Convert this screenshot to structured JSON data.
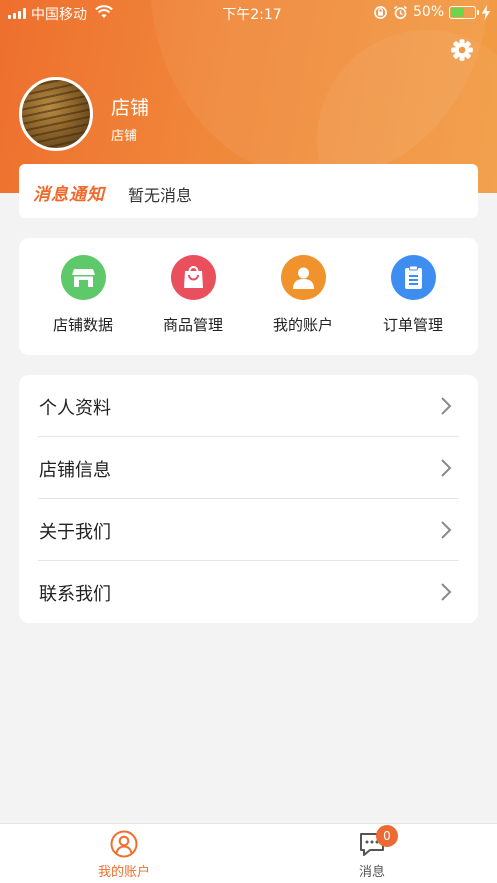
{
  "status_bar": {
    "carrier": "中国移动",
    "time": "下午2:17",
    "battery": "50%"
  },
  "profile": {
    "store_name": "店铺",
    "store_sub": "店铺"
  },
  "notice": {
    "tag": "消息通知",
    "text": "暂无消息"
  },
  "quick_menu": [
    {
      "label": "店铺数据",
      "icon": "store-icon",
      "color": "#5dc96b"
    },
    {
      "label": "商品管理",
      "icon": "shopping-bag-icon",
      "color": "#ea4f5e"
    },
    {
      "label": "我的账户",
      "icon": "user-icon",
      "color": "#f0932c"
    },
    {
      "label": "订单管理",
      "icon": "clipboard-icon",
      "color": "#3d8ef0"
    }
  ],
  "settings_list": [
    {
      "label": "个人资料"
    },
    {
      "label": "店铺信息"
    },
    {
      "label": "关于我们"
    },
    {
      "label": "联系我们"
    }
  ],
  "tabbar": {
    "items": [
      {
        "label": "我的账户",
        "icon": "user-circle-icon",
        "active": true
      },
      {
        "label": "消息",
        "icon": "chat-icon",
        "active": false
      }
    ],
    "message_badge": "0"
  },
  "colors": {
    "accent": "#ee6f2e",
    "tab_active": "#ee6f2e",
    "tab_inactive": "#555555",
    "page_bg": "#f3f3f3"
  }
}
